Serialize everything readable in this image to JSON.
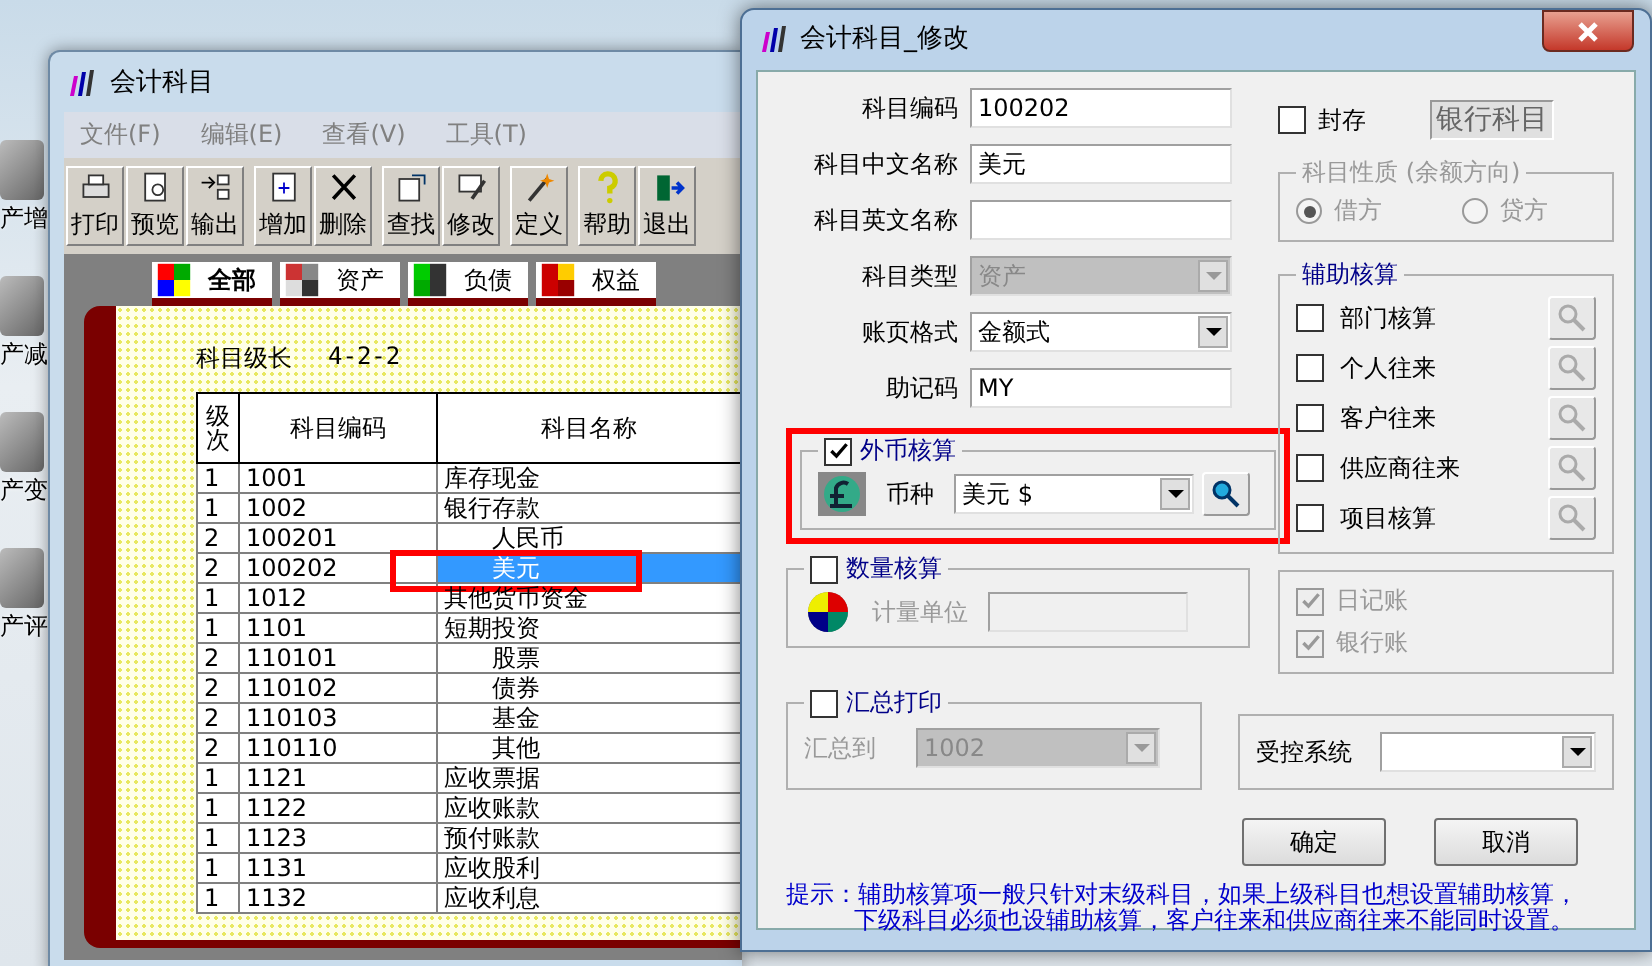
{
  "desktop_icons": [
    {
      "label": "产增"
    },
    {
      "label": "产减"
    },
    {
      "label": "产变"
    },
    {
      "label": "产评"
    }
  ],
  "main_window": {
    "title": "会计科目",
    "menu": [
      "文件(F)",
      "编辑(E)",
      "查看(V)",
      "工具(T)"
    ],
    "toolbar_groups": [
      [
        "打印",
        "预览",
        "输出"
      ],
      [
        "增加",
        "删除"
      ],
      [
        "查找",
        "修改"
      ],
      [
        "定义"
      ],
      [
        "帮助",
        "退出"
      ]
    ],
    "tabs": [
      {
        "label": "全部",
        "selected": true
      },
      {
        "label": "资产",
        "selected": false
      },
      {
        "label": "负债",
        "selected": false
      },
      {
        "label": "权益",
        "selected": false
      }
    ],
    "level_length_label": "科目级长",
    "level_length": "4-2-2",
    "table": {
      "columns": [
        "级次",
        "科目编码",
        "科目名称"
      ],
      "rows": [
        {
          "level": "1",
          "code": "1001",
          "name": "库存现金",
          "selected": false
        },
        {
          "level": "1",
          "code": "1002",
          "name": "银行存款",
          "selected": false,
          "children": [
            {
              "level": "2",
              "code": "100201",
              "name": "人民币",
              "selected": false
            },
            {
              "level": "2",
              "code": "100202",
              "name": "美元",
              "selected": true,
              "highlighted": true
            }
          ]
        },
        {
          "level": "1",
          "code": "1012",
          "name": "其他货币资金",
          "selected": false
        },
        {
          "level": "1",
          "code": "1101",
          "name": "短期投资",
          "selected": false,
          "children": [
            {
              "level": "2",
              "code": "110101",
              "name": "股票",
              "selected": false
            },
            {
              "level": "2",
              "code": "110102",
              "name": "债券",
              "selected": false
            },
            {
              "level": "2",
              "code": "110103",
              "name": "基金",
              "selected": false
            },
            {
              "level": "2",
              "code": "110110",
              "name": "其他",
              "selected": false
            }
          ]
        },
        {
          "level": "1",
          "code": "1121",
          "name": "应收票据",
          "selected": false
        },
        {
          "level": "1",
          "code": "1122",
          "name": "应收账款",
          "selected": false
        },
        {
          "level": "1",
          "code": "1123",
          "name": "预付账款",
          "selected": false
        },
        {
          "level": "1",
          "code": "1131",
          "name": "应收股利",
          "selected": false
        },
        {
          "level": "1",
          "code": "1132",
          "name": "应收利息",
          "selected": false
        }
      ]
    }
  },
  "dialog": {
    "title": "会计科目_修改",
    "fields": [
      {
        "kind": "text",
        "label": "科目编码",
        "value": "100202"
      },
      {
        "kind": "text",
        "label": "科目中文名称",
        "value": "美元"
      },
      {
        "kind": "text",
        "label": "科目英文名称"
      },
      {
        "kind": "select",
        "label": "科目类型",
        "value": "资产",
        "disabled": true
      },
      {
        "kind": "select",
        "label": "账页格式",
        "value": "金额式",
        "disabled": false
      },
      {
        "kind": "text",
        "label": "助记码",
        "value": "MY"
      }
    ],
    "sealed": {
      "label": "封存",
      "checked": false
    },
    "bank_label": "银行科目",
    "balance_direction": {
      "title": "科目性质 (余额方向)",
      "disabled": true,
      "options": [
        {
          "label": "借方",
          "selected": true
        },
        {
          "label": "贷方",
          "selected": false
        }
      ]
    },
    "auxiliary": {
      "title": "辅助核算",
      "items": [
        {
          "label": "部门核算",
          "checked": false
        },
        {
          "label": "个人往来",
          "checked": false
        },
        {
          "label": "客户往来",
          "checked": false
        },
        {
          "label": "供应商往来",
          "checked": false
        },
        {
          "label": "项目核算",
          "checked": false
        }
      ]
    },
    "ledgers": [
      {
        "label": "日记账",
        "checked": true,
        "disabled": true
      },
      {
        "label": "银行账",
        "checked": true,
        "disabled": true
      }
    ],
    "foreign_currency": {
      "label": "外币核算",
      "checked": true,
      "highlighted": true,
      "currency_label": "币种",
      "currency": "美元 $"
    },
    "quantity": {
      "label": "数量核算",
      "checked": false,
      "unit_label": "计量单位"
    },
    "summary_print": {
      "label": "汇总打印",
      "checked": false,
      "target_label": "汇总到",
      "target": "1002"
    },
    "controlled_system": {
      "label": "受控系统"
    },
    "buttons": [
      "确定",
      "取消"
    ],
    "hint_lines": [
      "提示：辅助核算项一般只针对末级科目，如果上级科目也想设置辅助核算，",
      "下级科目必须也设辅助核算，客户往来和供应商往来不能同时设置。"
    ]
  }
}
